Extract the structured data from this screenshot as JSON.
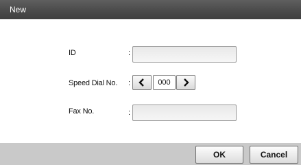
{
  "window": {
    "title": "New"
  },
  "form": {
    "id_label": "ID",
    "id_value": "",
    "speed_dial_label": "Speed Dial No.",
    "speed_dial_value": "000",
    "fax_label": "Fax No.",
    "fax_value": "",
    "colon": ":"
  },
  "buttons": {
    "ok": "OK",
    "cancel": "Cancel"
  },
  "icons": {
    "decrement": "chevron-left-icon",
    "increment": "chevron-right-icon"
  },
  "colors": {
    "titlebar": "#4b4b4b",
    "footer": "#c9c9c9"
  }
}
